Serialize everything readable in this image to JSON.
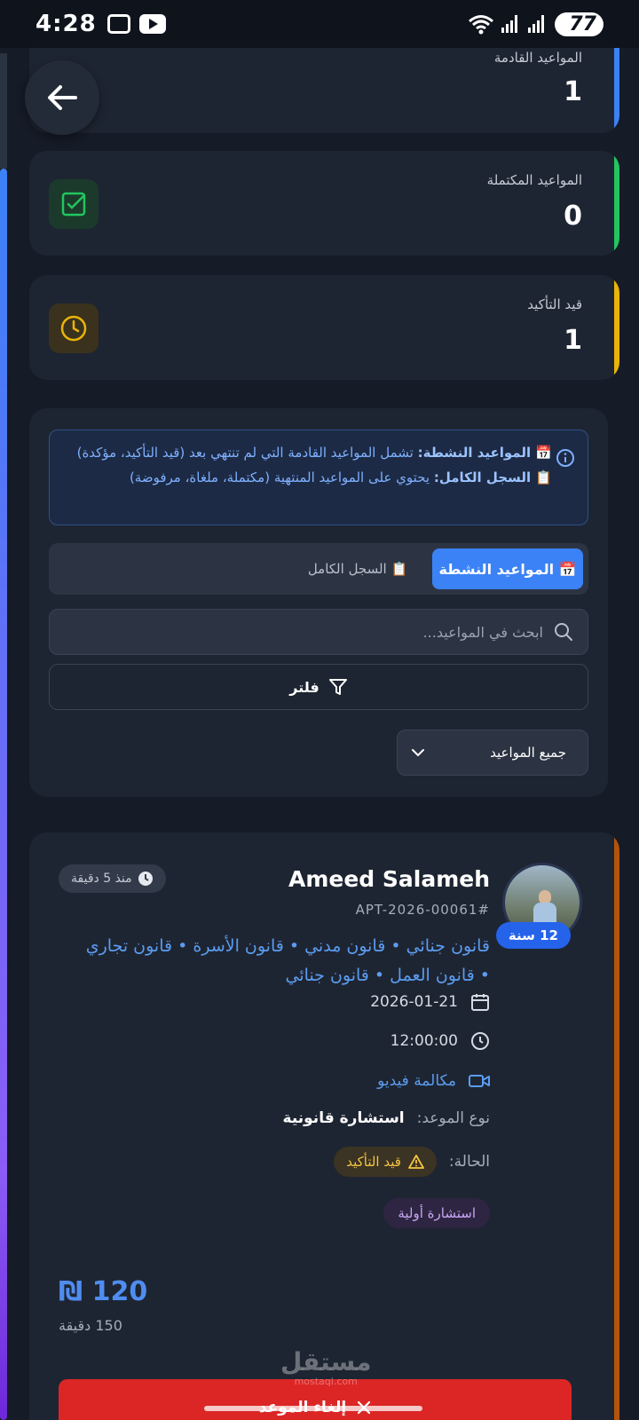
{
  "status_bar": {
    "time": "4:28",
    "battery": "77"
  },
  "stats": [
    {
      "label": "المواعيد القادمة",
      "value": "1",
      "color": "#3b82f6"
    },
    {
      "label": "المواعيد المكتملة",
      "value": "0",
      "color": "#22c55e"
    },
    {
      "label": "قيد التأكيد",
      "value": "1",
      "color": "#eab308"
    }
  ],
  "info": {
    "active_title": "📅 المواعيد النشطة:",
    "active_text": " تشمل المواعيد القادمة التي لم تنتهي بعد (قيد التأكيد، مؤكدة)",
    "history_title": "📋 السجل الكامل:",
    "history_text": " يحتوي على المواعيد المنتهية (مكتملة، ملغاة، مرفوضة)"
  },
  "tabs": {
    "active": "📅 المواعيد النشطة",
    "history": "📋 السجل الكامل"
  },
  "search": {
    "placeholder": "ابحث في المواعيد..."
  },
  "filter_label": "فلتر",
  "select_value": "جميع المواعيد",
  "appointment": {
    "client_name": "Ameed Salameh",
    "id": "APT-2026-00061#",
    "years": "12 سنة",
    "time_ago": "منذ 5 دقيقة",
    "specialties": "قانون جنائي • قانون مدني • قانون الأسرة • قانون تجاري • قانون العمل • قانون جنائي",
    "date": "2026-01-21",
    "time": "12:00:00",
    "method": "مكالمة فيديو",
    "type_label": "نوع الموعد:",
    "type_value": "استشارة قانونية",
    "status_label": "الحالة:",
    "status_value": "قيد التأكيد",
    "category": "استشارة أولية",
    "price": "₪ 120",
    "duration": "150 دقيقة",
    "cancel_label": "إلغاء الموعد"
  },
  "watermark": {
    "text": "مستقل",
    "sub": "mostaql.com"
  }
}
